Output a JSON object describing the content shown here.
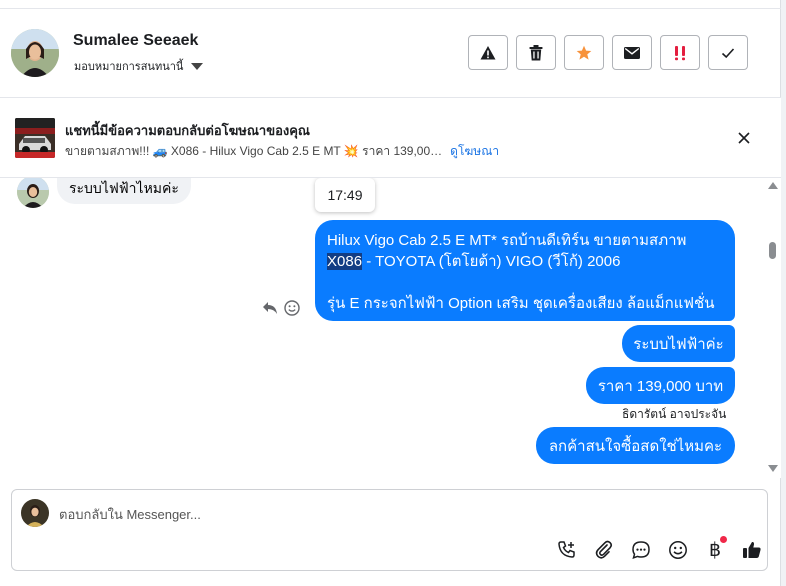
{
  "header": {
    "contact_name": "Sumalee Seeaek",
    "assign_label": "มอบหมายการสนทนานี้",
    "actions": [
      {
        "name": "report-icon"
      },
      {
        "name": "trash-icon"
      },
      {
        "name": "star-icon",
        "color": "#f7923b"
      },
      {
        "name": "envelope-icon"
      },
      {
        "name": "spam-icon",
        "color": "#e41e3f"
      },
      {
        "name": "check-icon"
      }
    ]
  },
  "ad_banner": {
    "title": "แชทนี้มีข้อความตอบกลับต่อโฆษณาของคุณ",
    "subtitle": "ขายตามสภาพ!!! 🚙 X086 - Hilux Vigo Cab 2.5 E MT 💥 ราคา 139,00…",
    "link_label": "ดูโฆษณา"
  },
  "conversation": {
    "incoming": [
      {
        "text": "ระบบไฟฟ้าไหมค่ะ"
      }
    ],
    "timestamp": "17:49",
    "outgoing_long": {
      "line1": "Hilux Vigo Cab 2.5 E MT* รถบ้านดีเทิร์น ขายตามสภาพ",
      "line2_code": "X086",
      "line2_rest": " - TOYOTA (โตโยต้า) VIGO (วีโก้) 2006",
      "line3": "รุ่น E กระจกไฟฟ้า Option เสริม ชุดเครื่องเสียง ล้อแม็กแฟชั่น"
    },
    "outgoing": [
      {
        "text": "ระบบไฟฟ้าค่ะ"
      },
      {
        "text": "ราคา 139,000 บาท"
      },
      {
        "text": "ลกค้าสนใจซื้อสดใช่ไหมคะ"
      }
    ],
    "sender_name": "ธิดารัตน์ อาจประจัน"
  },
  "composer": {
    "placeholder": "ตอบกลับใน Messenger...",
    "value": "",
    "tools": [
      {
        "name": "add-call-icon"
      },
      {
        "name": "paperclip-icon"
      },
      {
        "name": "saved-reply-icon"
      },
      {
        "name": "emoji-icon"
      },
      {
        "name": "baht-payment-icon",
        "glyph": "฿",
        "badge_color": "#f02849"
      },
      {
        "name": "thumbs-up-icon"
      }
    ]
  },
  "colors": {
    "outgoing_bubble": "#0a7cff",
    "incoming_bubble": "#f0f2f5",
    "link": "#1b74e4"
  }
}
